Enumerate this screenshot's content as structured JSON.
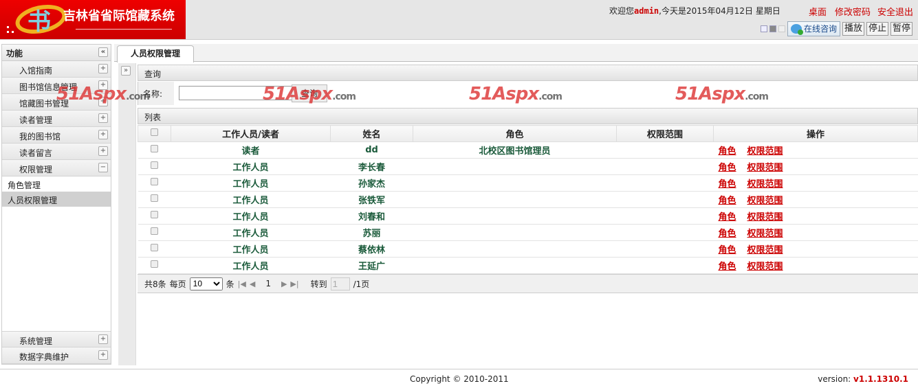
{
  "header": {
    "logo_text": "吉林省省际馆藏系统",
    "welcome_prefix": "欢迎您",
    "user": "admin",
    "welcome_suffix": ",今天是2015年04月12日  星期日",
    "links": [
      "桌面",
      "修改密码",
      "安全退出"
    ],
    "consult": "在线咨询",
    "buttons": [
      "播放",
      "停止",
      "暂停"
    ]
  },
  "sidebar": {
    "title": "功能",
    "groups": [
      "入馆指南",
      "图书馆信息管理",
      "馆藏图书管理",
      "读者管理",
      "我的图书馆",
      "读者留言",
      "权限管理"
    ],
    "sub_items": [
      "角色管理",
      "人员权限管理"
    ],
    "bottom_groups": [
      "系统管理",
      "数据字典维护"
    ]
  },
  "tab": "人员权限管理",
  "query": {
    "title": "查询",
    "name_label": "名称:",
    "name_value": "",
    "button": "查询"
  },
  "list": {
    "title": "列表",
    "columns": [
      "工作人员/读者",
      "姓名",
      "角色",
      "权限范围",
      "操作"
    ],
    "rows": [
      {
        "type": "读者",
        "name": "dd",
        "role": "北校区图书馆理员",
        "scope": ""
      },
      {
        "type": "工作人员",
        "name": "李长春",
        "role": "",
        "scope": ""
      },
      {
        "type": "工作人员",
        "name": "孙家杰",
        "role": "",
        "scope": ""
      },
      {
        "type": "工作人员",
        "name": "张铁军",
        "role": "",
        "scope": ""
      },
      {
        "type": "工作人员",
        "name": "刘春和",
        "role": "",
        "scope": ""
      },
      {
        "type": "工作人员",
        "name": "苏丽",
        "role": "",
        "scope": ""
      },
      {
        "type": "工作人员",
        "name": "蔡依林",
        "role": "",
        "scope": ""
      },
      {
        "type": "工作人员",
        "name": "王延广",
        "role": "",
        "scope": ""
      }
    ],
    "actions": [
      "角色",
      "权限范围"
    ]
  },
  "pager": {
    "total": "共8条",
    "per_page_label": "每页",
    "per_page": "10",
    "unit": "条",
    "current": "1",
    "goto_label": "转到",
    "goto_value": "1",
    "pages": "/1页"
  },
  "watermark": "51Aspx",
  "watermark_suffix": ".com",
  "footer": {
    "copyright": "Copyright © 2010-2011",
    "version_label": "version: ",
    "version": "v1.1.1310.1"
  }
}
